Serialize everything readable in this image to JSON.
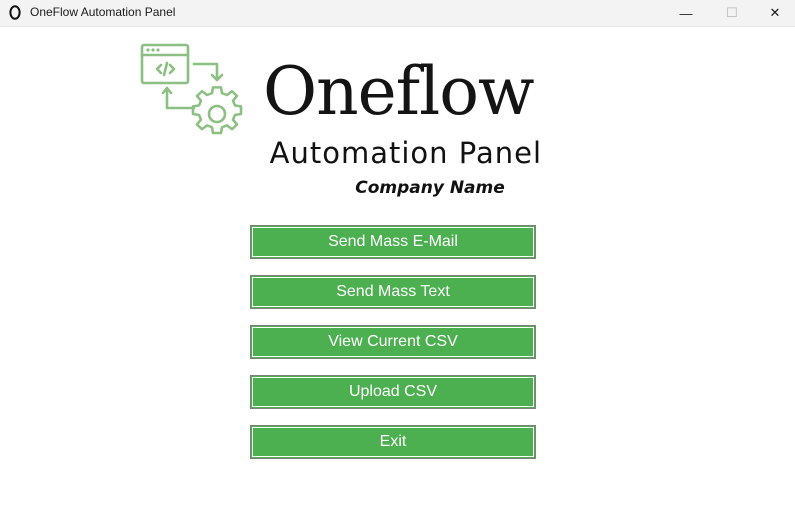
{
  "window": {
    "title": "OneFlow Automation Panel",
    "minimize_glyph": "—",
    "maximize_glyph": "☐",
    "close_glyph": "✕"
  },
  "header": {
    "logo_text": "Oneflow",
    "subtitle": "Automation Panel",
    "company": "Company Name",
    "logo_icon": "code-window-gear-icon",
    "logo_color": "#8cbf82"
  },
  "buttons": [
    {
      "label": "Send Mass E-Mail"
    },
    {
      "label": "Send Mass Text"
    },
    {
      "label": "View Current CSV"
    },
    {
      "label": "Upload CSV"
    },
    {
      "label": "Exit"
    }
  ],
  "colors": {
    "button_bg": "#4caf50",
    "button_text": "#ffffff"
  }
}
